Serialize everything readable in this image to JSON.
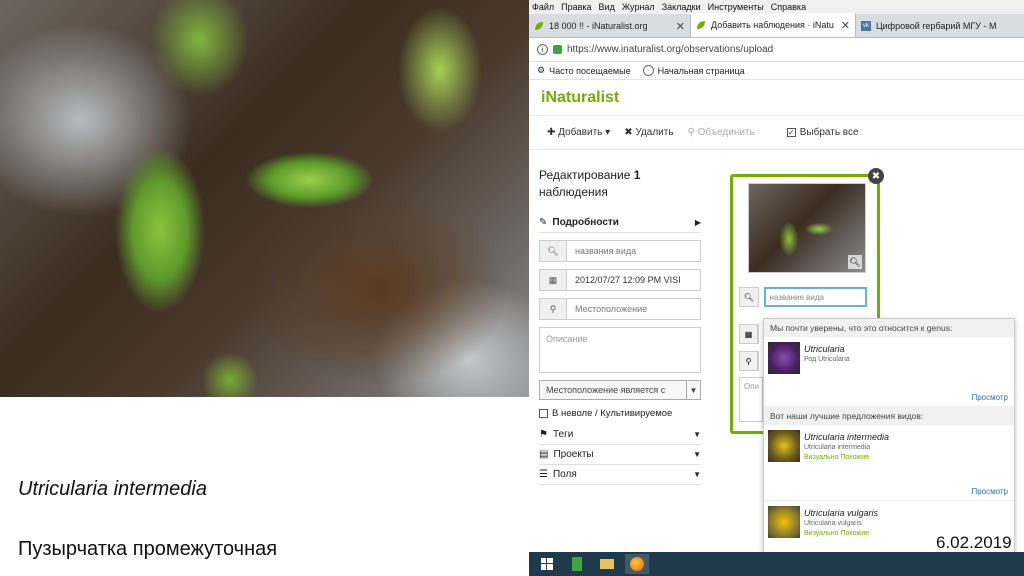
{
  "slide": {
    "latin_name": "Utricularia intermedia",
    "russian_name": "Пузырчатка промежуточная",
    "date": "6.02.2019"
  },
  "browser": {
    "menu": [
      "Файл",
      "Правка",
      "Вид",
      "Журнал",
      "Закладки",
      "Инструменты",
      "Справка"
    ],
    "tabs": [
      {
        "label": "18 000 !! - iNaturalist.org",
        "icon": "inaturalist-leaf-icon"
      },
      {
        "label": "Добавить наблюдения · iNatu",
        "icon": "inaturalist-leaf-icon"
      },
      {
        "label": "Цифровой гербарий МГУ - М",
        "icon": "vk-icon"
      }
    ],
    "url": "https://www.inaturalist.org/observations/upload",
    "bookmarks": [
      "Часто посещаемые",
      "Начальная страница"
    ]
  },
  "app": {
    "logo": "iNaturalist",
    "toolbar": {
      "add": "Добавить",
      "delete": "Удалить",
      "merge": "Объединить",
      "select_all": "Выбрать все"
    },
    "panel": {
      "title_prefix": "Редактирование",
      "count": "1",
      "title_suffix": "наблюдения",
      "details": "Подробности",
      "species_placeholder": "названия вида",
      "datetime": "2012/07/27 12:09 PM VISI",
      "location_placeholder": "Местоположение",
      "description_placeholder": "Описание",
      "location_public": "Местоположение является с",
      "captive": "В неволе / Культивируемое",
      "tags": "Теги",
      "projects": "Проекты",
      "fields": "Поля"
    },
    "card": {
      "species_placeholder": "название вида",
      "desc_placeholder": "Опи"
    },
    "suggestions": {
      "genus_header": "Мы почти уверены, что это относится к genus:",
      "species_header": "Вот наши лучшие предложения видов:",
      "view": "Просмотр",
      "items": [
        {
          "name": "Utricularia",
          "sub": "Род Utricularia",
          "visual": ""
        },
        {
          "name": "Utricularia intermedia",
          "sub": "Utricularia intermedia",
          "visual": "Визуально Похожие"
        },
        {
          "name": "Utricularia vulgaris",
          "sub": "Utricularia vulgaris",
          "visual": "Визуально Похожие"
        }
      ]
    }
  },
  "colors": {
    "brand": "#74ac00",
    "link": "#2a6fb0",
    "taskbar": "#1f3a4a"
  }
}
